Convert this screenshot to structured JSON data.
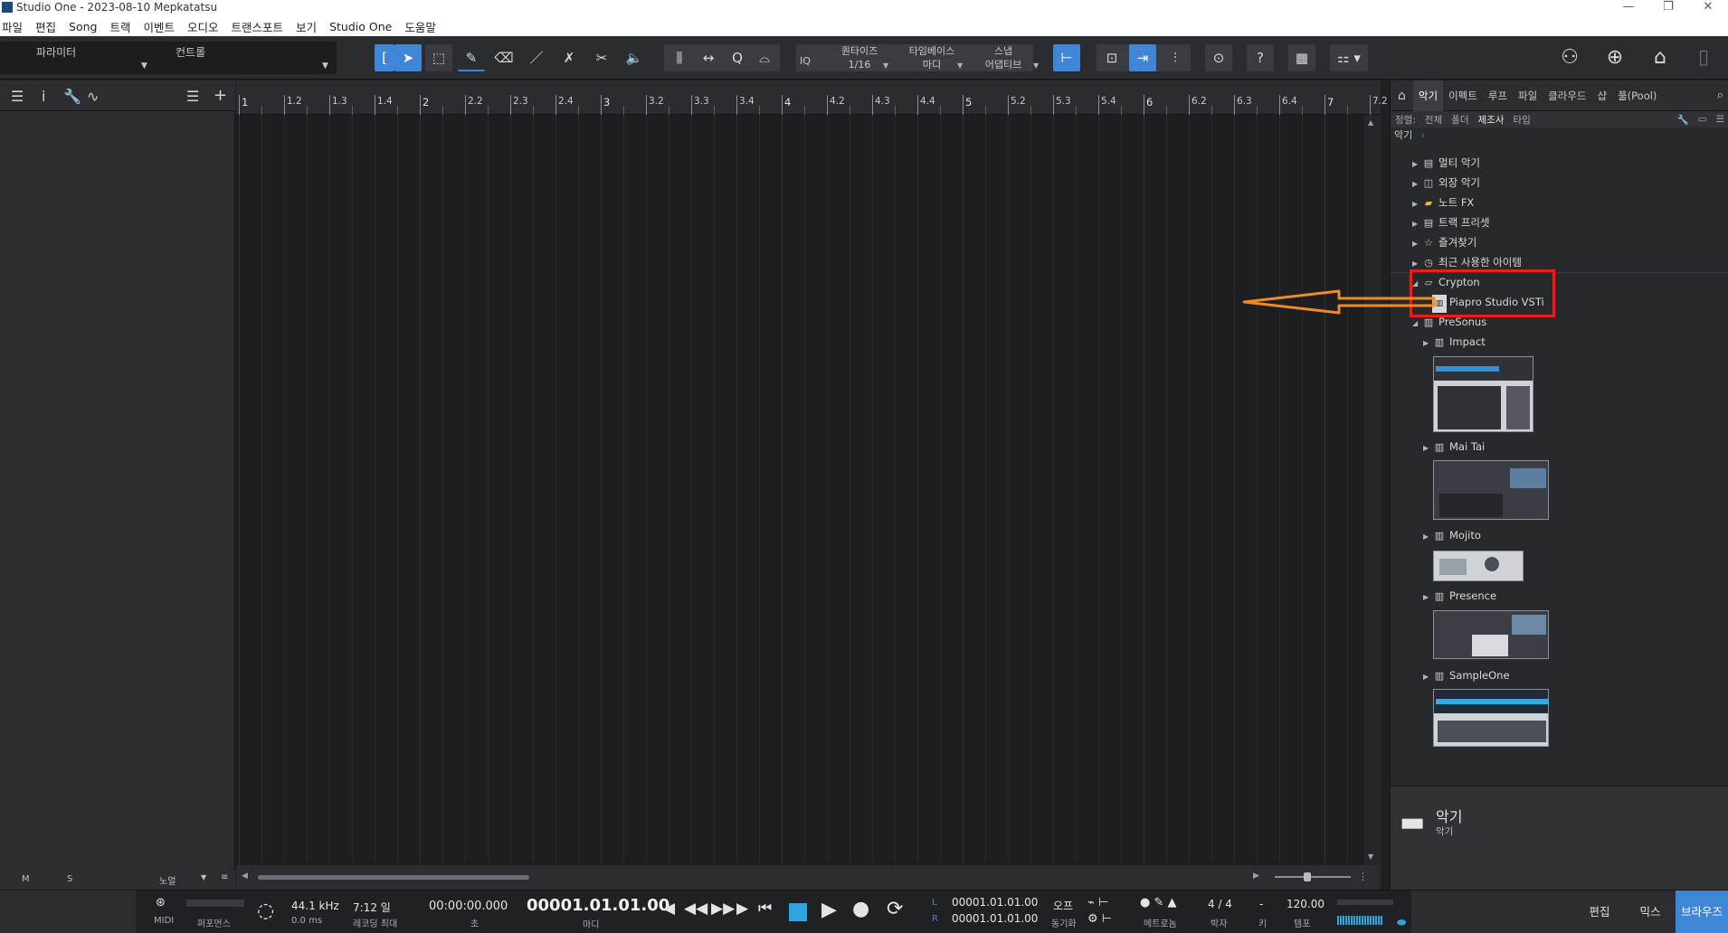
{
  "window": {
    "title": "Studio One - 2023-08-10 Mepkatatsu",
    "controls": [
      "—",
      "❐",
      "✕"
    ]
  },
  "menu": [
    "파일",
    "편집",
    "Song",
    "트랙",
    "이벤트",
    "오디오",
    "트랜스포트",
    "보기",
    "Studio One",
    "도움말"
  ],
  "toolbar": {
    "tab_parameter": "파라미터",
    "tab_control": "컨트롤",
    "quantize_label": "퀀타이즈",
    "quantize_value": "1/16",
    "timebase_label": "타임베이스",
    "timebase_value": "마디",
    "snap_label": "스냅",
    "snap_value": "어댑티브",
    "iq": "IQ"
  },
  "ruler": {
    "labels": [
      "1",
      "1.2",
      "1.3",
      "1.4",
      "2",
      "2.2",
      "2.3",
      "2.4",
      "3",
      "3.2",
      "3.3",
      "3.4",
      "4",
      "4.2",
      "4.3",
      "4.4",
      "5",
      "5.2",
      "5.3",
      "5.4",
      "6",
      "6.2",
      "6.3",
      "6.4",
      "7",
      "7.2"
    ]
  },
  "inspector_footer": {
    "m": "M",
    "s": "S",
    "mode": "노멀"
  },
  "browser": {
    "tabs": [
      "악기",
      "이펙트",
      "루프",
      "파일",
      "클라우드",
      "샵",
      "풀(Pool)"
    ],
    "sort_label": "정렬:",
    "sort_options": [
      "전체",
      "폴더",
      "제조사",
      "타입"
    ],
    "breadcrumb": "악기",
    "tree": [
      {
        "label": "멀티 악기",
        "icon": "folder-icon",
        "level": 0
      },
      {
        "label": "외장 악기",
        "icon": "external-icon",
        "level": 0
      },
      {
        "label": "노트 FX",
        "icon": "note-fx-icon",
        "level": 0
      },
      {
        "label": "트랙 프리셋",
        "icon": "preset-icon",
        "level": 0
      },
      {
        "label": "즐겨찾기",
        "icon": "star-icon",
        "level": 0
      },
      {
        "label": "최근 사용한 아이템",
        "icon": "clock-icon",
        "level": 0
      },
      {
        "label": "Crypton",
        "icon": "folder-open-icon",
        "level": 0
      },
      {
        "label": "Piapro Studio VSTi",
        "icon": "instrument-icon",
        "level": 1
      },
      {
        "label": "PreSonus",
        "icon": "presonus-icon",
        "level": 0
      },
      {
        "label": "Impact",
        "icon": "piano-icon",
        "level": 1
      },
      {
        "label": "Mai Tai",
        "icon": "piano-icon",
        "level": 1
      },
      {
        "label": "Mojito",
        "icon": "piano-icon",
        "level": 1
      },
      {
        "label": "Presence",
        "icon": "piano-icon",
        "level": 1
      },
      {
        "label": "SampleOne",
        "icon": "piano-icon",
        "level": 1
      }
    ],
    "footer_title": "악기",
    "footer_sub": "악기"
  },
  "transport": {
    "midi": "MIDI",
    "performance": "퍼포먼스",
    "sample_rate": "44.1 kHz",
    "latency": "0.0 ms",
    "record_time": "7:12 일",
    "record_label": "레코딩 최대",
    "time_secondary": "00:00:00.000",
    "time_secondary_unit": "초",
    "time_primary": "00001.01.01.00",
    "time_primary_unit": "마디",
    "loop_l": "L",
    "loop_r": "R",
    "loop_start": "00001.01.01.00",
    "loop_end": "00001.01.01.00",
    "sync_value": "오프",
    "sync_label": "동기화",
    "metronome_label": "메트로놈",
    "time_signature": "4 / 4",
    "time_signature_label": "박자",
    "key": "-",
    "key_label": "키",
    "tempo": "120.00",
    "tempo_label": "템포",
    "view_edit": "편집",
    "view_mix": "믹스",
    "view_browse": "브라우즈"
  },
  "colors": {
    "accent": "#3f86d6",
    "highlight_box": "#e32020",
    "annotation_arrow": "#f08a24"
  }
}
